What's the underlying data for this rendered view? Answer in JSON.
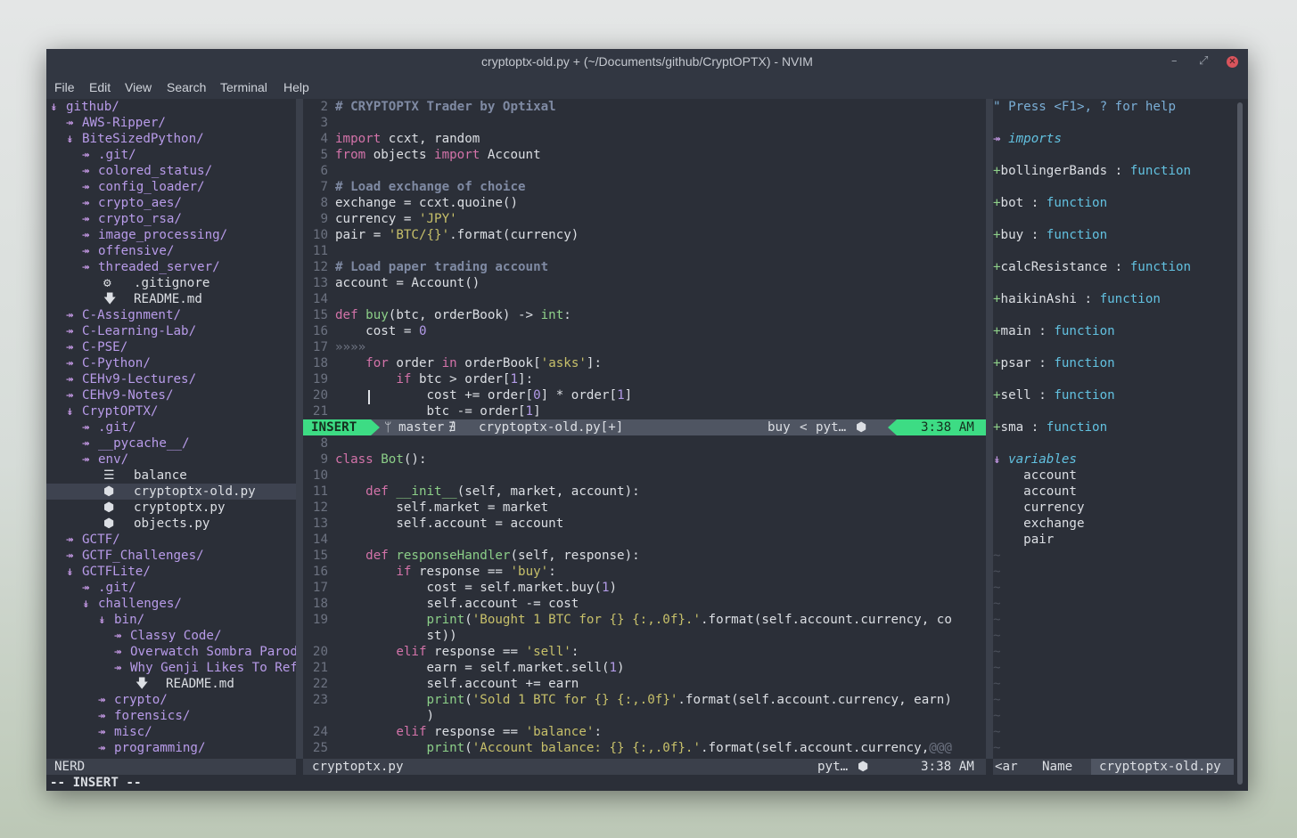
{
  "window": {
    "title": "cryptoptx-old.py + (~/Documents/github/CryptOPTX) - NVIM",
    "controls": {
      "minimize": "–",
      "maximize": "⤢",
      "close": "✕"
    }
  },
  "menu": [
    "File",
    "Edit",
    "View",
    "Search",
    "Terminal",
    "Help"
  ],
  "colors": {
    "insert_mode": "#3ddc84",
    "accent_purple": "#b89be9",
    "keyword": "#d373a9",
    "string": "#c7c06a",
    "tag_function": "#62c1e0"
  },
  "tree": [
    {
      "indent": 0,
      "arrow": "↡",
      "name": "github/",
      "kind": "dir"
    },
    {
      "indent": 1,
      "arrow": "↠",
      "name": "AWS-Ripper/",
      "kind": "dir"
    },
    {
      "indent": 1,
      "arrow": "↡",
      "name": "BiteSizedPython/",
      "kind": "dir"
    },
    {
      "indent": 2,
      "arrow": "↠",
      "name": ".git/",
      "kind": "dir"
    },
    {
      "indent": 2,
      "arrow": "↠",
      "name": "colored_status/",
      "kind": "dir"
    },
    {
      "indent": 2,
      "arrow": "↠",
      "name": "config_loader/",
      "kind": "dir"
    },
    {
      "indent": 2,
      "arrow": "↠",
      "name": "crypto_aes/",
      "kind": "dir"
    },
    {
      "indent": 2,
      "arrow": "↠",
      "name": "crypto_rsa/",
      "kind": "dir"
    },
    {
      "indent": 2,
      "arrow": "↠",
      "name": "image_processing/",
      "kind": "dir"
    },
    {
      "indent": 2,
      "arrow": "↠",
      "name": "offensive/",
      "kind": "dir"
    },
    {
      "indent": 2,
      "arrow": "↠",
      "name": "threaded_server/",
      "kind": "dir"
    },
    {
      "indent": 2,
      "icon": "⚙",
      "name": ".gitignore",
      "kind": "file"
    },
    {
      "indent": 2,
      "icon": "🡇",
      "name": "README.md",
      "kind": "file"
    },
    {
      "indent": 1,
      "arrow": "↠",
      "name": "C-Assignment/",
      "kind": "dir"
    },
    {
      "indent": 1,
      "arrow": "↠",
      "name": "C-Learning-Lab/",
      "kind": "dir"
    },
    {
      "indent": 1,
      "arrow": "↠",
      "name": "C-PSE/",
      "kind": "dir"
    },
    {
      "indent": 1,
      "arrow": "↠",
      "name": "C-Python/",
      "kind": "dir"
    },
    {
      "indent": 1,
      "arrow": "↠",
      "name": "CEHv9-Lectures/",
      "kind": "dir"
    },
    {
      "indent": 1,
      "arrow": "↠",
      "name": "CEHv9-Notes/",
      "kind": "dir"
    },
    {
      "indent": 1,
      "arrow": "↡",
      "name": "CryptOPTX/",
      "kind": "dir"
    },
    {
      "indent": 2,
      "arrow": "↠",
      "name": ".git/",
      "kind": "dir"
    },
    {
      "indent": 2,
      "arrow": "↠",
      "name": "__pycache__/",
      "kind": "dir"
    },
    {
      "indent": 2,
      "arrow": "↠",
      "name": "env/",
      "kind": "dir"
    },
    {
      "indent": 2,
      "icon": "☰",
      "name": "balance",
      "kind": "file"
    },
    {
      "indent": 2,
      "icon": "⬢",
      "name": "cryptoptx-old.py",
      "kind": "file",
      "selected": true
    },
    {
      "indent": 2,
      "icon": "⬢",
      "name": "cryptoptx.py",
      "kind": "file"
    },
    {
      "indent": 2,
      "icon": "⬢",
      "name": "objects.py",
      "kind": "file"
    },
    {
      "indent": 1,
      "arrow": "↠",
      "name": "GCTF/",
      "kind": "dir"
    },
    {
      "indent": 1,
      "arrow": "↠",
      "name": "GCTF_Challenges/",
      "kind": "dir"
    },
    {
      "indent": 1,
      "arrow": "↡",
      "name": "GCTFLite/",
      "kind": "dir"
    },
    {
      "indent": 2,
      "arrow": "↠",
      "name": ".git/",
      "kind": "dir"
    },
    {
      "indent": 2,
      "arrow": "↡",
      "name": "challenges/",
      "kind": "dir"
    },
    {
      "indent": 3,
      "arrow": "↡",
      "name": "bin/",
      "kind": "dir"
    },
    {
      "indent": 4,
      "arrow": "↠",
      "name": "Classy Code/",
      "kind": "dir"
    },
    {
      "indent": 4,
      "arrow": "↠",
      "name": "Overwatch Sombra Parod",
      "kind": "dir"
    },
    {
      "indent": 4,
      "arrow": "↠",
      "name": "Why Genji Likes To Ref",
      "kind": "dir"
    },
    {
      "indent": 4,
      "icon": "🡇",
      "name": "README.md",
      "kind": "file"
    },
    {
      "indent": 3,
      "arrow": "↠",
      "name": "crypto/",
      "kind": "dir"
    },
    {
      "indent": 3,
      "arrow": "↠",
      "name": "forensics/",
      "kind": "dir"
    },
    {
      "indent": 3,
      "arrow": "↠",
      "name": "misc/",
      "kind": "dir"
    },
    {
      "indent": 3,
      "arrow": "↠",
      "name": "programming/",
      "kind": "dir"
    }
  ],
  "code_top": [
    {
      "n": "2",
      "t": [
        [
          "cm",
          "# CRYPTOPTX Trader by Optixal"
        ]
      ]
    },
    {
      "n": "3",
      "t": []
    },
    {
      "n": "4",
      "t": [
        [
          "kw",
          "import"
        ],
        [
          "tx",
          " ccxt, random"
        ]
      ]
    },
    {
      "n": "5",
      "t": [
        [
          "kw",
          "from"
        ],
        [
          "tx",
          " objects "
        ],
        [
          "kw",
          "import"
        ],
        [
          "tx",
          " Account"
        ]
      ]
    },
    {
      "n": "6",
      "t": []
    },
    {
      "n": "7",
      "t": [
        [
          "cm",
          "# Load exchange of choice"
        ]
      ]
    },
    {
      "n": "8",
      "t": [
        [
          "tx",
          "exchange = ccxt.quoine()"
        ]
      ]
    },
    {
      "n": "9",
      "t": [
        [
          "tx",
          "currency = "
        ],
        [
          "st",
          "'JPY'"
        ]
      ]
    },
    {
      "n": "10",
      "t": [
        [
          "tx",
          "pair = "
        ],
        [
          "st",
          "'BTC/{}'"
        ],
        [
          "tx",
          ".format(currency)"
        ]
      ]
    },
    {
      "n": "11",
      "t": []
    },
    {
      "n": "12",
      "t": [
        [
          "cm",
          "# Load paper trading account"
        ]
      ]
    },
    {
      "n": "13",
      "t": [
        [
          "tx",
          "account = Account()"
        ]
      ]
    },
    {
      "n": "14",
      "t": []
    },
    {
      "n": "15",
      "t": [
        [
          "kw",
          "def"
        ],
        [
          "tx",
          " "
        ],
        [
          "fn",
          "buy"
        ],
        [
          "tx",
          "(btc, orderBook) -> "
        ],
        [
          "ty",
          "int"
        ],
        [
          "tx",
          ":"
        ]
      ]
    },
    {
      "n": "16",
      "t": [
        [
          "tx",
          "    cost = "
        ],
        [
          "nm",
          "0"
        ]
      ]
    },
    {
      "n": "17",
      "t": [
        [
          "num",
          "»»»»"
        ]
      ]
    },
    {
      "n": "18",
      "t": [
        [
          "tx",
          "    "
        ],
        [
          "kw",
          "for"
        ],
        [
          "tx",
          " order "
        ],
        [
          "kw",
          "in"
        ],
        [
          "tx",
          " orderBook["
        ],
        [
          "st",
          "'asks'"
        ],
        [
          "tx",
          "]:"
        ]
      ]
    },
    {
      "n": "19",
      "t": [
        [
          "tx",
          "        "
        ],
        [
          "kw",
          "if"
        ],
        [
          "tx",
          " btc > order["
        ],
        [
          "nm",
          "1"
        ],
        [
          "tx",
          "]:"
        ]
      ]
    },
    {
      "n": "20",
      "t": [
        [
          "tx",
          "            cost += order["
        ],
        [
          "nm",
          "0"
        ],
        [
          "tx",
          "] * order["
        ],
        [
          "nm",
          "1"
        ],
        [
          "tx",
          "]"
        ]
      ]
    },
    {
      "n": "21",
      "t": [
        [
          "tx",
          "            btc -= order["
        ],
        [
          "nm",
          "1"
        ],
        [
          "tx",
          "]"
        ]
      ]
    }
  ],
  "status_top": {
    "mode": "INSERT",
    "branch": "master",
    "branch_flag": "∄",
    "file": "cryptoptx-old.py[+]",
    "func": "buy",
    "sep": "<",
    "ft": "pyt…",
    "time": "3:38 AM"
  },
  "code_bottom": [
    {
      "n": "8",
      "t": []
    },
    {
      "n": "9",
      "t": [
        [
          "kw",
          "class"
        ],
        [
          "tx",
          " "
        ],
        [
          "fn",
          "Bot"
        ],
        [
          "tx",
          "():"
        ]
      ]
    },
    {
      "n": "10",
      "t": []
    },
    {
      "n": "11",
      "t": [
        [
          "tx",
          "    "
        ],
        [
          "kw",
          "def"
        ],
        [
          "tx",
          " "
        ],
        [
          "fn",
          "__init__"
        ],
        [
          "tx",
          "(self, market, account):"
        ]
      ]
    },
    {
      "n": "12",
      "t": [
        [
          "tx",
          "        self.market = market"
        ]
      ]
    },
    {
      "n": "13",
      "t": [
        [
          "tx",
          "        self.account = account"
        ]
      ]
    },
    {
      "n": "14",
      "t": []
    },
    {
      "n": "15",
      "t": [
        [
          "tx",
          "    "
        ],
        [
          "kw",
          "def"
        ],
        [
          "tx",
          " "
        ],
        [
          "fn",
          "responseHandler"
        ],
        [
          "tx",
          "(self, response):"
        ]
      ]
    },
    {
      "n": "16",
      "t": [
        [
          "tx",
          "        "
        ],
        [
          "kw",
          "if"
        ],
        [
          "tx",
          " response == "
        ],
        [
          "st",
          "'buy'"
        ],
        [
          "tx",
          ":"
        ]
      ]
    },
    {
      "n": "17",
      "t": [
        [
          "tx",
          "            cost = self.market.buy("
        ],
        [
          "nm",
          "1"
        ],
        [
          "tx",
          ")"
        ]
      ]
    },
    {
      "n": "18",
      "t": [
        [
          "tx",
          "            self.account -= cost"
        ]
      ]
    },
    {
      "n": "19",
      "t": [
        [
          "tx",
          "            "
        ],
        [
          "fn",
          "print"
        ],
        [
          "tx",
          "("
        ],
        [
          "st",
          "'Bought 1 BTC for {} {:,.0f}.'"
        ],
        [
          "tx",
          ".format(self.account.currency, co"
        ]
      ]
    },
    {
      "n": "",
      "t": [
        [
          "tx",
          "            st))"
        ]
      ]
    },
    {
      "n": "20",
      "t": [
        [
          "tx",
          "        "
        ],
        [
          "kw",
          "elif"
        ],
        [
          "tx",
          " response == "
        ],
        [
          "st",
          "'sell'"
        ],
        [
          "tx",
          ":"
        ]
      ]
    },
    {
      "n": "21",
      "t": [
        [
          "tx",
          "            earn = self.market.sell("
        ],
        [
          "nm",
          "1"
        ],
        [
          "tx",
          ")"
        ]
      ]
    },
    {
      "n": "22",
      "t": [
        [
          "tx",
          "            self.account += earn"
        ]
      ]
    },
    {
      "n": "23",
      "t": [
        [
          "tx",
          "            "
        ],
        [
          "fn",
          "print"
        ],
        [
          "tx",
          "("
        ],
        [
          "st",
          "'Sold 1 BTC for {} {:,.0f}'"
        ],
        [
          "tx",
          ".format(self.account.currency, earn)"
        ]
      ]
    },
    {
      "n": "",
      "t": [
        [
          "tx",
          "            )"
        ]
      ]
    },
    {
      "n": "24",
      "t": [
        [
          "tx",
          "        "
        ],
        [
          "kw",
          "elif"
        ],
        [
          "tx",
          " response == "
        ],
        [
          "st",
          "'balance'"
        ],
        [
          "tx",
          ":"
        ]
      ]
    },
    {
      "n": "25",
      "t": [
        [
          "tx",
          "            "
        ],
        [
          "fn",
          "print"
        ],
        [
          "tx",
          "("
        ],
        [
          "st",
          "'Account balance: {} {:,.0f}.'"
        ],
        [
          "tx",
          ".format(self.account.currency,"
        ],
        [
          "num",
          "@@@"
        ]
      ]
    }
  ],
  "tagbar": {
    "help": "\" Press <F1>, ? for help",
    "imports_arrow": "↠",
    "imports_label": "imports",
    "functions": [
      {
        "name": "bollingerBands",
        "kind": "function"
      },
      {
        "name": "bot",
        "kind": "function"
      },
      {
        "name": "buy",
        "kind": "function"
      },
      {
        "name": "calcResistance",
        "kind": "function"
      },
      {
        "name": "haikinAshi",
        "kind": "function"
      },
      {
        "name": "main",
        "kind": "function"
      },
      {
        "name": "psar",
        "kind": "function"
      },
      {
        "name": "sell",
        "kind": "function"
      },
      {
        "name": "sma",
        "kind": "function"
      }
    ],
    "variables_arrow": "↡",
    "variables_label": "variables",
    "variables": [
      "account",
      "account",
      "currency",
      "exchange",
      "pair"
    ],
    "tilde": "~"
  },
  "status_bottom": {
    "tree_label": "NERD",
    "file": "cryptoptx.py",
    "ft": "pyt…",
    "time": "3:38 AM",
    "tag_left": "<ar",
    "tag_mid": "Name",
    "tag_file": "cryptoptx-old.py"
  },
  "cmdline": "-- INSERT --"
}
